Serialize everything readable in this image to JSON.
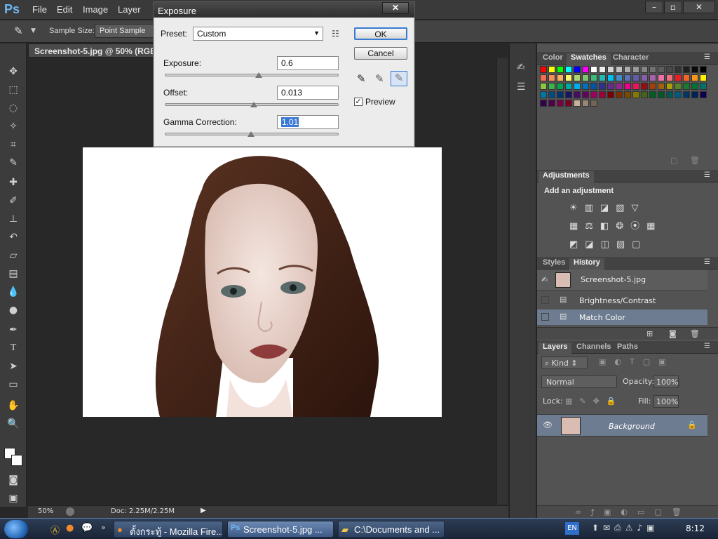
{
  "app": {
    "logo": "Ps",
    "menus": [
      "File",
      "Edit",
      "Image",
      "Layer"
    ],
    "window_buttons": [
      "–",
      "▫",
      "✕"
    ]
  },
  "options": {
    "sample_size_label": "Sample Size:",
    "sample_size_value": "Point Sample"
  },
  "document": {
    "tab_title": "Screenshot-5.jpg @ 50% (RGB",
    "zoom": "50%",
    "doc_info": "Doc: 2.25M/2.25M"
  },
  "dialog": {
    "title": "Exposure",
    "close": "✕",
    "preset_label": "Preset:",
    "preset_value": "Custom",
    "exposure_label": "Exposure:",
    "exposure_value": "0.6",
    "exposure_level": 0.6,
    "offset_label": "Offset:",
    "offset_value": "0.013",
    "offset_level": 0.013,
    "gamma_label": "Gamma Correction:",
    "gamma_value": "1.01",
    "gamma_level": 1.01,
    "ok_label": "OK",
    "cancel_label": "Cancel",
    "preview_label": "Preview",
    "preview_checked": true
  },
  "panels": {
    "color_tabs": [
      "Color",
      "Swatches",
      "Character"
    ],
    "adjustments_tab": "Adjustments",
    "add_adjustment": "Add an adjustment",
    "history_tabs": [
      "Styles",
      "History"
    ],
    "history_snapshot": "Screenshot-5.jpg",
    "history_items": [
      "Brightness/Contrast",
      "Match Color"
    ],
    "layers_tabs": [
      "Layers",
      "Channels",
      "Paths"
    ],
    "kind_label": "Kind",
    "blend_mode": "Normal",
    "opacity_label": "Opacity:",
    "opacity_value": "100%",
    "lock_label": "Lock:",
    "fill_label": "Fill:",
    "fill_value": "100%",
    "layer_name": "Background"
  },
  "taskbar": {
    "items": [
      "ตั้งกระทู้ - Mozilla Fire...",
      "Screenshot-5.jpg ...",
      "C:\\Documents and ..."
    ],
    "lang": "EN",
    "clock": "8:12"
  }
}
